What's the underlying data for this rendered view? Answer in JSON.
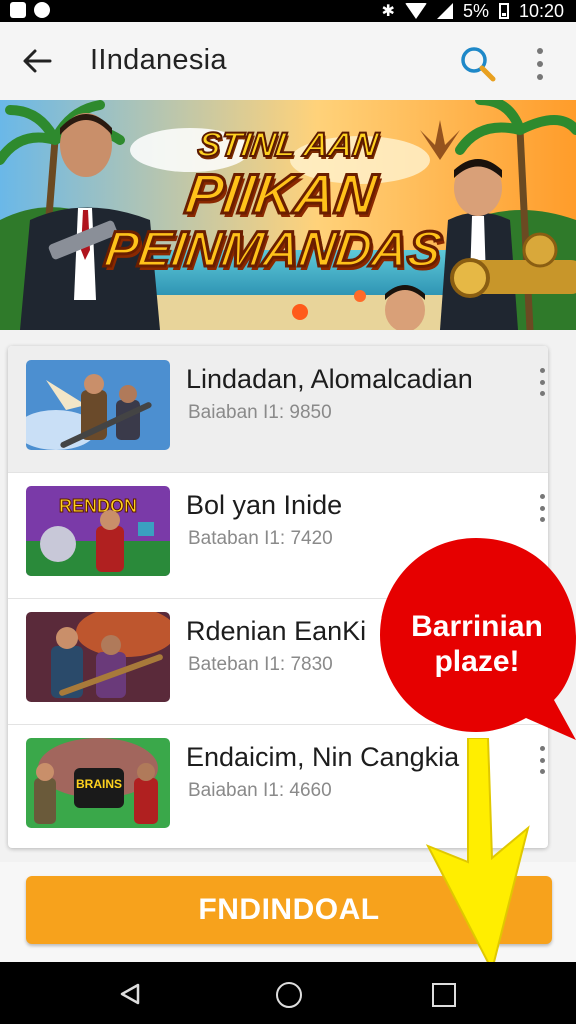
{
  "status_bar": {
    "battery": "5%",
    "time": "10:20"
  },
  "app_bar": {
    "title": "IIndanesia"
  },
  "banner": {
    "line1": "STINL AAN",
    "line2": "PIIKAN",
    "line3": "PEINMANDAS"
  },
  "list": [
    {
      "title": "Lindadan, Alomalcadian",
      "subtitle": "Baiaban I1: 9850",
      "selected": true
    },
    {
      "title": "Bol yan Inide",
      "subtitle": "Bataban I1: 7420",
      "selected": false
    },
    {
      "title": "Rdenian EanKi",
      "subtitle": "Bateban I1: 7830",
      "selected": false
    },
    {
      "title": "Endaicim, Nin Cangkia",
      "subtitle": "Baiaban I1: 4660",
      "selected": false
    }
  ],
  "callout": {
    "line1": "Barrinian",
    "line2": "plaze!"
  },
  "cta": {
    "label": "FNDINDOAL"
  },
  "colors": {
    "accent": "#f7a21c",
    "callout": "#e60000",
    "arrow": "#ffee00"
  }
}
